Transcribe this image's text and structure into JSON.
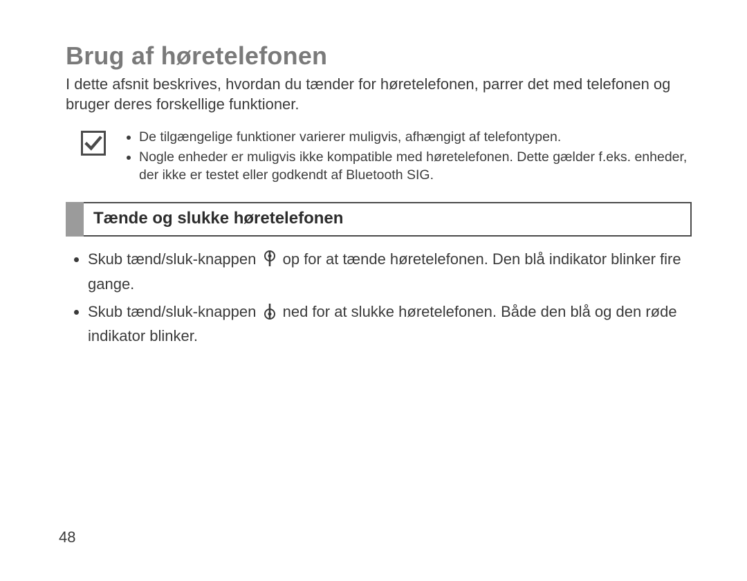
{
  "heading": "Brug af høretelefonen",
  "intro": "I dette afsnit beskrives, hvordan du tænder for høretelefonen, parrer det med telefonen og bruger deres forskellige funktioner.",
  "note": {
    "icon_name": "checkbox-checked-icon",
    "items": [
      "De tilgængelige funktioner varierer muligvis, afhængigt af telefontypen.",
      "Nogle enheder er muligvis ikke kompatible med høretelefonen. Dette gælder f.eks. enheder, der ikke er testet eller godkendt af Bluetooth SIG."
    ]
  },
  "subheading": "Tænde og slukke høretelefonen",
  "body": {
    "items": [
      {
        "pre": "Skub tænd/sluk-knappen ",
        "icon": "power-switch-up-icon",
        "post": " op for at tænde høretelefonen. Den blå indikator blinker fire gange."
      },
      {
        "pre": "Skub tænd/sluk-knappen ",
        "icon": "power-switch-down-icon",
        "post": " ned for at slukke høretelefonen. Både den blå og den røde indikator blinker."
      }
    ]
  },
  "page_number": "48"
}
